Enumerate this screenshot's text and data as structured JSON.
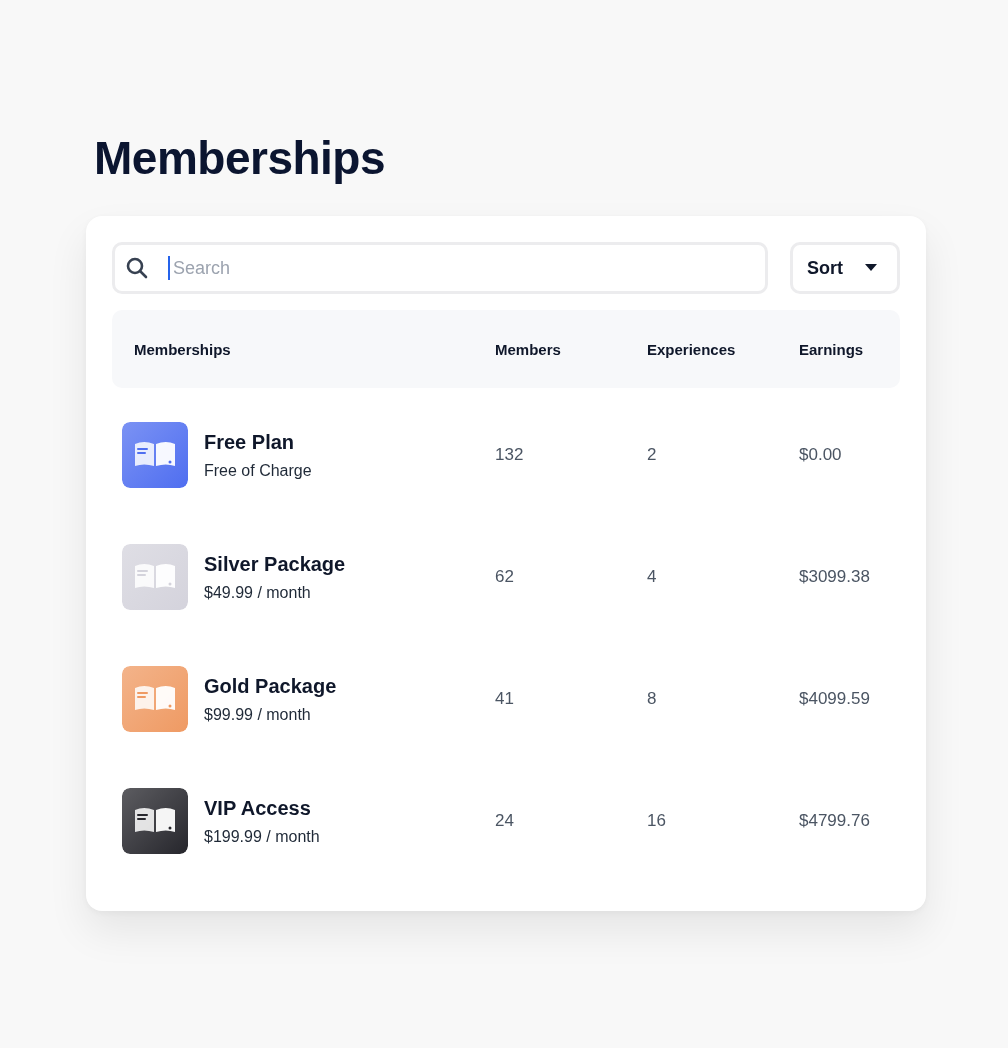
{
  "title": "Memberships",
  "search": {
    "placeholder": "Search"
  },
  "sort": {
    "label": "Sort"
  },
  "table": {
    "columns": [
      "Memberships",
      "Members",
      "Experiences",
      "Earnings"
    ],
    "rows": [
      {
        "name": "Free Plan",
        "price": "Free of Charge",
        "members": "132",
        "experiences": "2",
        "earnings": "$0.00",
        "color": "#4f6ef0"
      },
      {
        "name": "Silver Package",
        "price": "$49.99 / month",
        "members": "62",
        "experiences": "4",
        "earnings": "$3099.38",
        "color": "#d4d3dc"
      },
      {
        "name": "Gold Package",
        "price": "$99.99 / month",
        "members": "41",
        "experiences": "8",
        "earnings": "$4099.59",
        "color": "#ef9a63"
      },
      {
        "name": "VIP Access",
        "price": "$199.99 / month",
        "members": "24",
        "experiences": "16",
        "earnings": "$4799.76",
        "color": "#26262c"
      }
    ]
  }
}
